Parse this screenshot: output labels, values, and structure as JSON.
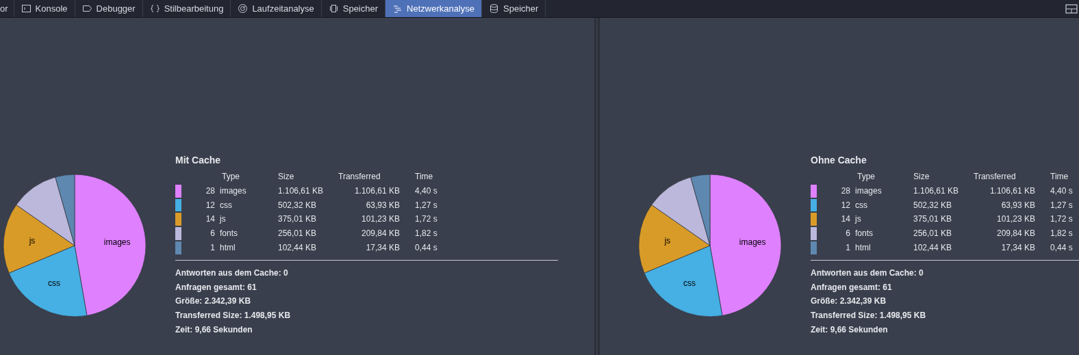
{
  "tabs": [
    {
      "label": "or",
      "kind": "none",
      "selected": false
    },
    {
      "label": "Konsole",
      "kind": "console",
      "selected": false
    },
    {
      "label": "Debugger",
      "kind": "debugger",
      "selected": false
    },
    {
      "label": "Stilbearbeitung",
      "kind": "braces",
      "selected": false
    },
    {
      "label": "Laufzeitanalyse",
      "kind": "gauge",
      "selected": false
    },
    {
      "label": "Speicher",
      "kind": "chip",
      "selected": false
    },
    {
      "label": "Netzwerkanalyse",
      "kind": "network",
      "selected": true
    },
    {
      "label": "Speicher",
      "kind": "database",
      "selected": false
    }
  ],
  "panels": [
    {
      "title": "Mit Cache",
      "columns": [
        "Type",
        "Size",
        "Transferred",
        "Time"
      ],
      "rows": [
        {
          "color": "#df80ff",
          "count": "28",
          "type": "images",
          "size": "1.106,61 KB",
          "transferred": "1.106,61 KB",
          "time": "4,40 s"
        },
        {
          "color": "#46afe3",
          "count": "12",
          "type": "css",
          "size": "502,32 KB",
          "transferred": "63,93 KB",
          "time": "1,27 s"
        },
        {
          "color": "#d99b28",
          "count": "14",
          "type": "js",
          "size": "375,01 KB",
          "transferred": "101,23 KB",
          "time": "1,72 s"
        },
        {
          "color": "#bcb8db",
          "count": "6",
          "type": "fonts",
          "size": "256,01 KB",
          "transferred": "209,84 KB",
          "time": "1,82 s"
        },
        {
          "color": "#5e88b0",
          "count": "1",
          "type": "html",
          "size": "102,44 KB",
          "transferred": "17,34 KB",
          "time": "0,44 s"
        }
      ],
      "summary": [
        "Antworten aus dem Cache: 0",
        "Anfragen gesamt: 61",
        "Größe: 2.342,39 KB",
        "Transferred Size: 1.498,95 KB",
        "Zeit: 9,66 Sekunden"
      ],
      "chart_data": {
        "type": "pie",
        "values": [
          47.24,
          21.45,
          16.01,
          10.93,
          4.37
        ],
        "annotations": [
          "images",
          "css",
          "js"
        ]
      }
    },
    {
      "title": "Ohne Cache",
      "columns": [
        "Type",
        "Size",
        "Transferred",
        "Time"
      ],
      "rows": [
        {
          "color": "#df80ff",
          "count": "28",
          "type": "images",
          "size": "1.106,61 KB",
          "transferred": "1.106,61 KB",
          "time": "4,40 s"
        },
        {
          "color": "#46afe3",
          "count": "12",
          "type": "css",
          "size": "502,32 KB",
          "transferred": "63,93 KB",
          "time": "1,27 s"
        },
        {
          "color": "#d99b28",
          "count": "14",
          "type": "js",
          "size": "375,01 KB",
          "transferred": "101,23 KB",
          "time": "1,72 s"
        },
        {
          "color": "#bcb8db",
          "count": "6",
          "type": "fonts",
          "size": "256,01 KB",
          "transferred": "209,84 KB",
          "time": "1,82 s"
        },
        {
          "color": "#5e88b0",
          "count": "1",
          "type": "html",
          "size": "102,44 KB",
          "transferred": "17,34 KB",
          "time": "0,44 s"
        }
      ],
      "summary": [
        "Antworten aus dem Cache: 0",
        "Anfragen gesamt: 61",
        "Größe: 2.342,39 KB",
        "Transferred Size: 1.498,95 KB",
        "Zeit: 9,66 Sekunden"
      ],
      "chart_data": {
        "type": "pie",
        "values": [
          47.24,
          21.45,
          16.01,
          10.93,
          4.37
        ],
        "annotations": [
          "images",
          "css",
          "js"
        ]
      }
    }
  ]
}
